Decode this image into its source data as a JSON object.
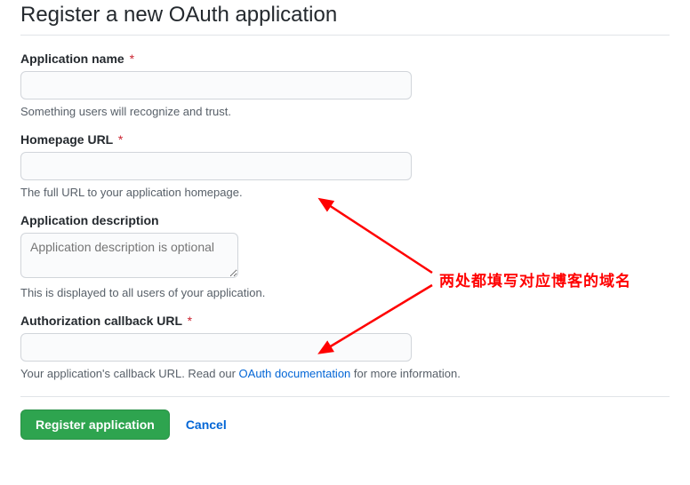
{
  "page": {
    "title": "Register a new OAuth application"
  },
  "fields": {
    "appName": {
      "label": "Application name",
      "required": "*",
      "help": "Something users will recognize and trust."
    },
    "homepage": {
      "label": "Homepage URL",
      "required": "*",
      "help": "The full URL to your application homepage."
    },
    "description": {
      "label": "Application description",
      "placeholder": "Application description is optional",
      "help": "This is displayed to all users of your application."
    },
    "callback": {
      "label": "Authorization callback URL",
      "required": "*",
      "help_before": "Your application's callback URL. Read our ",
      "help_link": "OAuth documentation",
      "help_after": " for more information."
    }
  },
  "actions": {
    "submit": "Register application",
    "cancel": "Cancel"
  },
  "annotation": {
    "text": "两处都填写对应博客的域名"
  }
}
